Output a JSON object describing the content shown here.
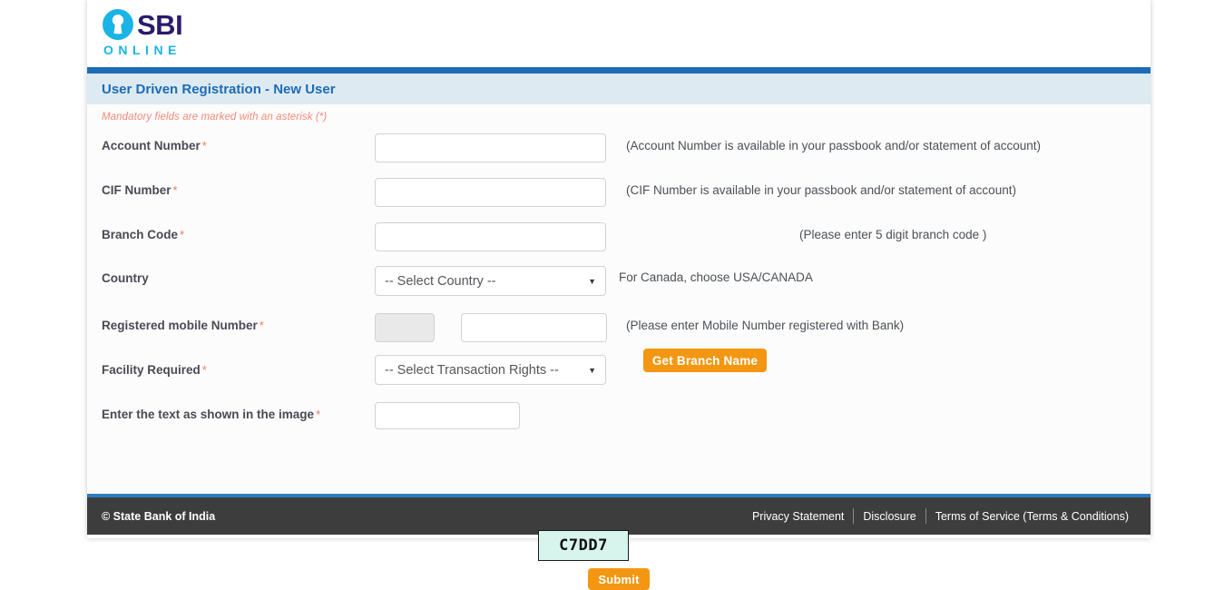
{
  "brand": {
    "name": "SBI",
    "tagline": "ONLINE",
    "logo_icon": "sbi-keyhole-circle-icon",
    "navy": "#2A1B6B",
    "cyan": "#18B6E8"
  },
  "header": {
    "title": "User Driven Registration - New User",
    "accent_color": "#1C6CB5",
    "title_bar_bg": "#DEEAF1"
  },
  "form": {
    "mandatory_note": "Mandatory fields are marked with an asterisk (*)",
    "required_marker": "*",
    "fields": [
      {
        "label": "Account Number",
        "required": true,
        "value": "",
        "placeholder": "",
        "hint": "(Account Number is available in your passbook and/or statement of account)"
      },
      {
        "label": "CIF Number",
        "required": true,
        "value": "",
        "placeholder": "",
        "hint": "(CIF Number is available in your passbook and/or statement of account)"
      },
      {
        "label": "Branch Code",
        "required": true,
        "value": "",
        "placeholder": "",
        "hint": "(Please enter 5 digit branch code )",
        "button_label": "Get Branch Name"
      },
      {
        "label": "Country",
        "required": false,
        "selected": "-- Select Country --",
        "hint": "For Canada, choose USA/CANADA"
      },
      {
        "label": "Registered mobile Number",
        "required": true,
        "prefix_value": "",
        "value": "",
        "hint": "(Please enter Mobile Number registered with Bank)"
      },
      {
        "label": "Facility Required",
        "required": true,
        "selected": "-- Select Transaction Rights --",
        "hint": ""
      },
      {
        "label": "Enter the text as shown in the image",
        "required": true,
        "value": "",
        "captcha_text": "C7DD7"
      }
    ],
    "submit_label": "Submit",
    "button_color": "#F39713"
  },
  "footer": {
    "copyright": "© State Bank of India",
    "links": [
      "Privacy Statement",
      "Disclosure",
      "Terms of Service (Terms & Conditions)"
    ],
    "bg": "#3D3D3D",
    "rule_color": "#2E7CC0"
  }
}
